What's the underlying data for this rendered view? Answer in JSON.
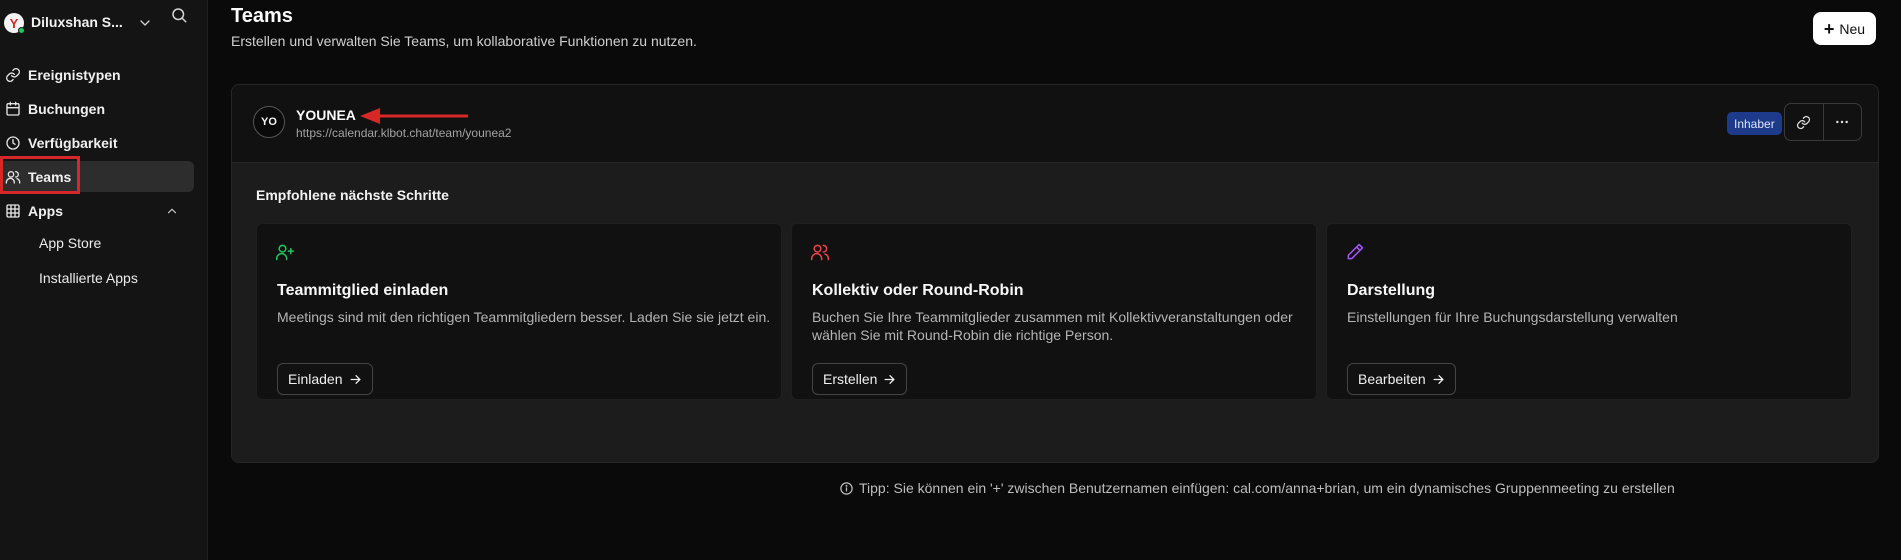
{
  "sidebar": {
    "user_name": "Diluxshan S...",
    "logo_letter": "Y",
    "items": [
      {
        "label": "Ereignistypen",
        "icon": "link-icon"
      },
      {
        "label": "Buchungen",
        "icon": "calendar-icon"
      },
      {
        "label": "Verfügbarkeit",
        "icon": "clock-icon"
      },
      {
        "label": "Teams",
        "icon": "users-icon",
        "active": true
      },
      {
        "label": "Apps",
        "icon": "grid-icon",
        "expanded": true
      }
    ],
    "sub_items": [
      {
        "label": "App Store"
      },
      {
        "label": "Installierte Apps"
      }
    ]
  },
  "header": {
    "title": "Teams",
    "subtitle": "Erstellen und verwalten Sie Teams, um kollaborative Funktionen zu nutzen.",
    "new_label": "Neu"
  },
  "team": {
    "avatar_initials": "YO",
    "name": "YOUNEA",
    "url": "https://calendar.klbot.chat/team/younea2",
    "role_badge": "Inhaber"
  },
  "steps": {
    "heading": "Empfohlene nächste Schritte",
    "cards": [
      {
        "icon": "user-plus-icon",
        "title": "Teammitglied einladen",
        "description": "Meetings sind mit den richtigen Teammitgliedern besser. Laden Sie sie jetzt ein.",
        "action": "Einladen"
      },
      {
        "icon": "users-icon",
        "title": "Kollektiv oder Round-Robin",
        "description": "Buchen Sie Ihre Teammitglieder zusammen mit Kollektivveranstaltungen oder wählen Sie mit Round-Robin die richtige Person.",
        "action": "Erstellen"
      },
      {
        "icon": "pencil-icon",
        "title": "Darstellung",
        "description": "Einstellungen für Ihre Buchungsdarstellung verwalten",
        "action": "Bearbeiten"
      }
    ]
  },
  "tip": "Tipp: Sie können ein '+' zwischen Benutzernamen einfügen: cal.com/anna+brian, um ein dynamisches Gruppenmeeting zu erstellen",
  "colors": {
    "background": "#0a0a0a",
    "sidebar": "#141414",
    "active_nav": "#2d2d2d",
    "badge": "#1e3a8a",
    "highlight": "#d62828",
    "invite_icon": "#22c55e",
    "collective_icon": "#ef4444",
    "appearance_icon": "#a855f7"
  }
}
